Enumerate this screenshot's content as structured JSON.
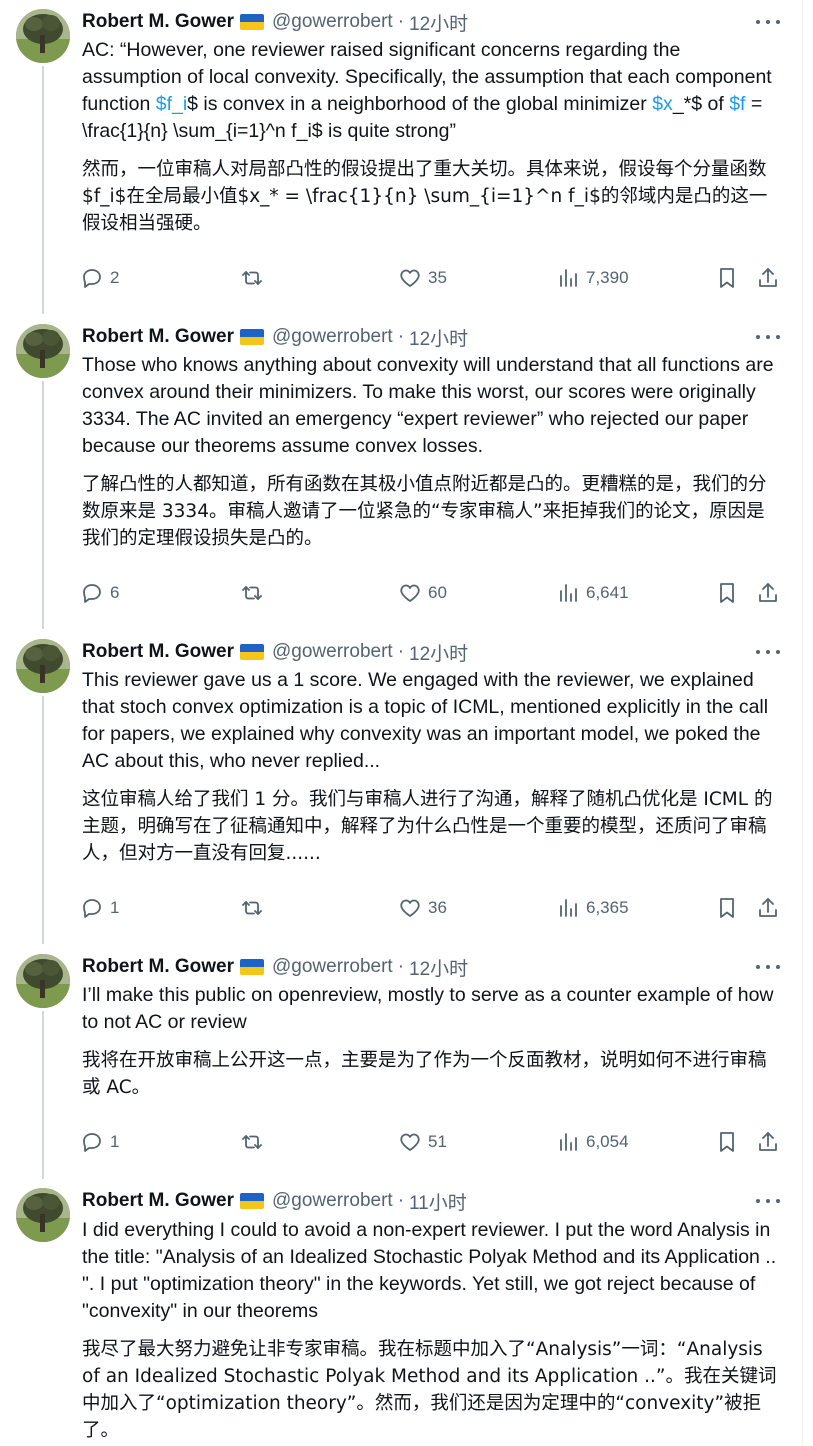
{
  "thread": [
    {
      "author": "Robert M. Gower",
      "handle": "@gowerrobert",
      "dot": "·",
      "time": "12小时",
      "text_en_parts": [
        "AC: “However, one reviewer raised significant concerns regarding the assumption of local convexity. Specifically, the assumption that each component function ",
        "$f_i",
        "$ is convex in a neighborhood of the global minimizer ",
        "$x",
        "_*$ of ",
        "$f",
        " = \\frac{1}{n} \\sum_{i=1}^n f_i$ is quite strong”"
      ],
      "text_zh": "然而，一位审稿人对局部凸性的假设提出了重大关切。具体来说，假设每个分量函数$f_i$在全局最小值$x_* = \\frac{1}{n} \\sum_{i=1}^n f_i$的邻域内是凸的这一假设相当强硬。",
      "replies": "2",
      "retweets": "",
      "likes": "35",
      "views": "7,390"
    },
    {
      "author": "Robert M. Gower",
      "handle": "@gowerrobert",
      "dot": "·",
      "time": "12小时",
      "text_en": "Those who knows anything about convexity will understand that all functions are convex around their minimizers. To make this worst, our scores were originally 3334. The AC invited an emergency “expert reviewer” who rejected our paper because our theorems assume convex losses.",
      "text_zh": "了解凸性的人都知道，所有函数在其极小值点附近都是凸的。更糟糕的是，我们的分数原来是 3334。审稿人邀请了一位紧急的“专家审稿人”来拒掉我们的论文，原因是我们的定理假设损失是凸的。",
      "replies": "6",
      "retweets": "",
      "likes": "60",
      "views": "6,641"
    },
    {
      "author": "Robert M. Gower",
      "handle": "@gowerrobert",
      "dot": "·",
      "time": "12小时",
      "text_en": "This reviewer gave us a 1 score. We engaged with the reviewer, we explained that stoch convex optimization is a topic of ICML, mentioned explicitly in the call for papers, we explained why convexity was an important model, we poked the AC about this, who never replied...",
      "text_zh": "这位审稿人给了我们 1 分。我们与审稿人进行了沟通，解释了随机凸优化是 ICML 的主题，明确写在了征稿通知中，解释了为什么凸性是一个重要的模型，还质问了审稿人，但对方一直没有回复......",
      "replies": "1",
      "retweets": "",
      "likes": "36",
      "views": "6,365"
    },
    {
      "author": "Robert M. Gower",
      "handle": "@gowerrobert",
      "dot": "·",
      "time": "12小时",
      "text_en": "I’ll make this public on openreview, mostly to serve as a counter example of how to not AC or review",
      "text_zh": "我将在开放审稿上公开这一点，主要是为了作为一个反面教材，说明如何不进行审稿或 AC。",
      "replies": "1",
      "retweets": "",
      "likes": "51",
      "views": "6,054"
    },
    {
      "author": "Robert M. Gower",
      "handle": "@gowerrobert",
      "dot": "·",
      "time": "11小时",
      "text_en": "I did everything I could to avoid a non-expert reviewer. I put the word Analysis in the title: \"Analysis of an Idealized Stochastic Polyak Method and its Application .. \". I put \"optimization theory\" in the keywords. Yet still, we got reject because of \"convexity\" in our theorems",
      "text_zh": "我尽了最大努力避免让非专家审稿。我在标题中加入了“Analysis”一词：“Analysis of an Idealized Stochastic Polyak Method and its Application ..”。我在关键词中加入了“optimization theory”。然而，我们还是因为定理中的“convexity”被拒了。"
    }
  ],
  "colors": {
    "text": "#0f1419",
    "secondary": "#536471",
    "link": "#1d9bf0",
    "thread_line": "#cfd9de",
    "flag_blue": "#1e63c4",
    "flag_yellow": "#f5c518"
  },
  "icons": {
    "reply": "reply-icon",
    "retweet": "retweet-icon",
    "like": "heart-icon",
    "views": "views-icon",
    "bookmark": "bookmark-icon",
    "share": "share-icon",
    "more": "more-icon"
  }
}
